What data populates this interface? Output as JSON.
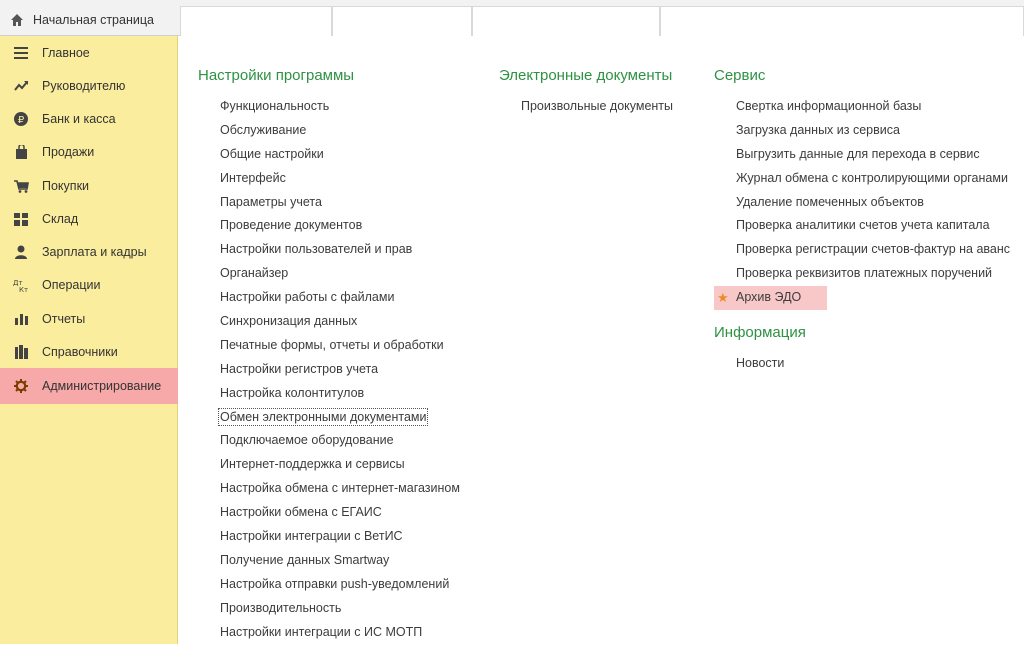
{
  "home_tab": {
    "label": "Начальная страница",
    "icon": "home-icon"
  },
  "sidebar": {
    "items": [
      {
        "label": "Главное",
        "icon": "hamburger-icon"
      },
      {
        "label": "Руководителю",
        "icon": "trend-icon"
      },
      {
        "label": "Банк и касса",
        "icon": "ruble-icon"
      },
      {
        "label": "Продажи",
        "icon": "bag-icon"
      },
      {
        "label": "Покупки",
        "icon": "cart-icon"
      },
      {
        "label": "Склад",
        "icon": "grid-icon"
      },
      {
        "label": "Зарплата и кадры",
        "icon": "person-icon"
      },
      {
        "label": "Операции",
        "icon": "dt-kt-icon"
      },
      {
        "label": "Отчеты",
        "icon": "bar-chart-icon"
      },
      {
        "label": "Справочники",
        "icon": "books-icon"
      },
      {
        "label": "Администрирование",
        "icon": "gear-icon",
        "active": true
      }
    ]
  },
  "columns": [
    {
      "sections": [
        {
          "title": "Настройки программы",
          "links": [
            "Функциональность",
            "Обслуживание",
            "Общие настройки",
            "Интерфейс",
            "Параметры учета",
            "Проведение документов",
            "Настройки пользователей и прав",
            "Органайзер",
            "Настройки работы с файлами",
            "Синхронизация данных",
            "Печатные формы, отчеты и обработки",
            "Настройки регистров учета",
            "Настройка колонтитулов",
            "Обмен электронными документами",
            "Подключаемое оборудование",
            "Интернет-поддержка и сервисы",
            "Настройка обмена с интернет-магазином",
            "Настройки обмена с ЕГАИС",
            "Настройки интеграции с ВетИС",
            "Получение данных Smartway",
            "Настройка отправки push-уведомлений",
            "Производительность",
            "Настройки интеграции с ИС МОТП"
          ]
        }
      ]
    },
    {
      "sections": [
        {
          "title": "Электронные документы",
          "links": [
            "Произвольные документы"
          ]
        }
      ]
    },
    {
      "sections": [
        {
          "title": "Сервис",
          "links": [
            "Свертка информационной базы",
            "Загрузка данных из сервиса",
            "Выгрузить данные для перехода в сервис",
            "Журнал обмена с контролирующими органами",
            "Удаление помеченных объектов",
            "Проверка аналитики счетов учета капитала",
            "Проверка регистрации счетов-фактур на аванс",
            "Проверка реквизитов платежных поручений",
            "Архив ЭДО"
          ]
        },
        {
          "title": "Информация",
          "links": [
            "Новости"
          ]
        }
      ]
    }
  ],
  "colors": {
    "section_title": "#2e9243",
    "sidebar_bg": "#fbed9e",
    "active_bg": "#f7a8a8",
    "favorite_star": "#f08a24"
  }
}
